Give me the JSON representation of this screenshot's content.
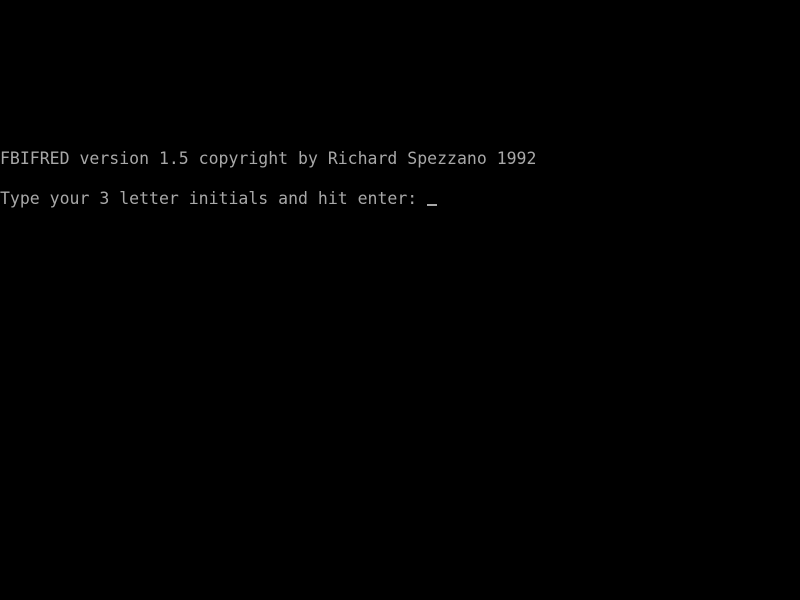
{
  "console": {
    "title_line": "FBIFRED version 1.5 copyright by Richard Spezzano 1992",
    "prompt_line": "Type your 3 letter initials and hit enter: ",
    "input_value": "",
    "cursor_glyph": "_"
  },
  "colors": {
    "background": "#000000",
    "text": "#a8a8a8"
  }
}
